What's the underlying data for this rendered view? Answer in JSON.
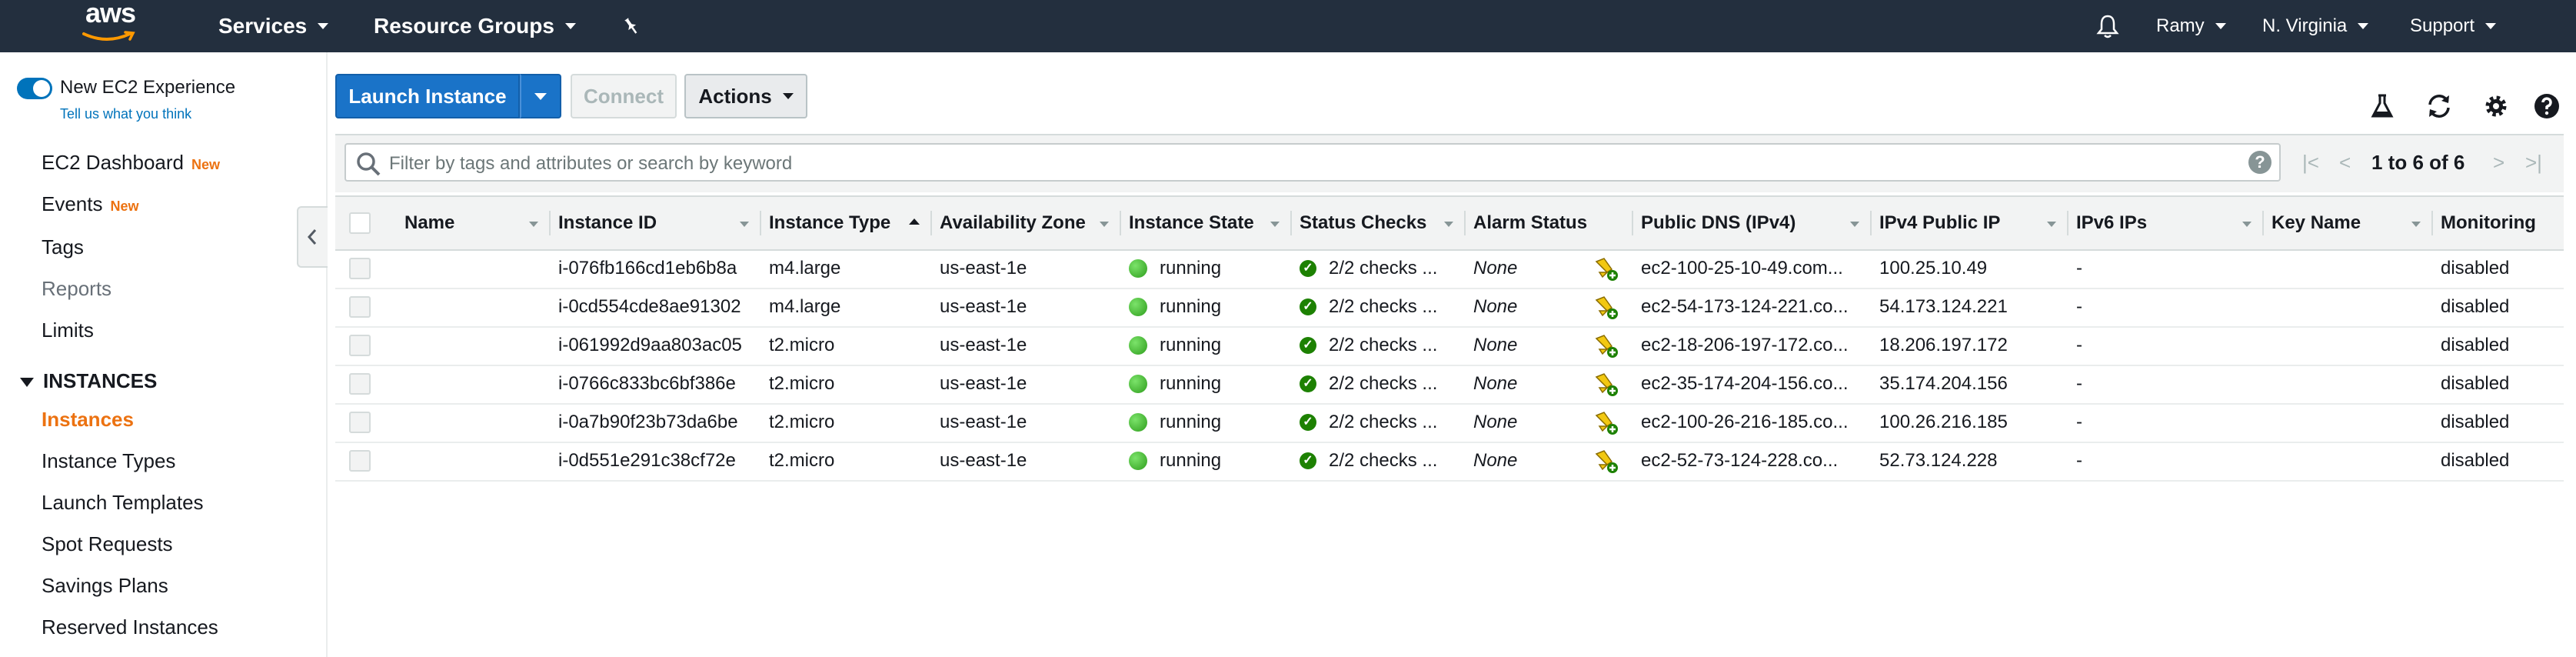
{
  "topnav": {
    "logo": "aws",
    "services": "Services",
    "resource_groups": "Resource Groups",
    "pin_icon": "pin-icon",
    "bell_icon": "bell-icon",
    "user": "Ramy",
    "region": "N. Virginia",
    "support": "Support"
  },
  "sidebar": {
    "toggle_label": "New EC2 Experience",
    "feedback_link": "Tell us what you think",
    "items": [
      {
        "label": "EC2 Dashboard",
        "badge": "New"
      },
      {
        "label": "Events",
        "badge": "New"
      },
      {
        "label": "Tags"
      },
      {
        "label": "Reports"
      },
      {
        "label": "Limits"
      }
    ],
    "section": "INSTANCES",
    "instances_items": [
      {
        "label": "Instances"
      },
      {
        "label": "Instance Types"
      },
      {
        "label": "Launch Templates"
      },
      {
        "label": "Spot Requests"
      },
      {
        "label": "Savings Plans"
      },
      {
        "label": "Reserved Instances"
      }
    ]
  },
  "toolbar": {
    "launch": "Launch Instance",
    "connect": "Connect",
    "actions": "Actions"
  },
  "filter": {
    "placeholder": "Filter by tags and attributes or search by keyword",
    "pager": "1 to 6 of 6"
  },
  "table": {
    "columns": [
      "Name",
      "Instance ID",
      "Instance Type",
      "Availability Zone",
      "Instance State",
      "Status Checks",
      "Alarm Status",
      "Public DNS (IPv4)",
      "IPv4 Public IP",
      "IPv6 IPs",
      "Key Name",
      "Monitoring"
    ],
    "rows": [
      {
        "name": "",
        "id": "i-076fb166cd1eb6b8a",
        "type": "m4.large",
        "az": "us-east-1e",
        "state": "running",
        "checks": "2/2 checks ...",
        "alarm": "None",
        "dns": "ec2-100-25-10-49.com...",
        "ip": "100.25.10.49",
        "ipv6": "-",
        "key": "",
        "monitoring": "disabled"
      },
      {
        "name": "",
        "id": "i-0cd554cde8ae91302",
        "type": "m4.large",
        "az": "us-east-1e",
        "state": "running",
        "checks": "2/2 checks ...",
        "alarm": "None",
        "dns": "ec2-54-173-124-221.co...",
        "ip": "54.173.124.221",
        "ipv6": "-",
        "key": "",
        "monitoring": "disabled"
      },
      {
        "name": "",
        "id": "i-061992d9aa803ac05",
        "type": "t2.micro",
        "az": "us-east-1e",
        "state": "running",
        "checks": "2/2 checks ...",
        "alarm": "None",
        "dns": "ec2-18-206-197-172.co...",
        "ip": "18.206.197.172",
        "ipv6": "-",
        "key": "",
        "monitoring": "disabled"
      },
      {
        "name": "",
        "id": "i-0766c833bc6bf386e",
        "type": "t2.micro",
        "az": "us-east-1e",
        "state": "running",
        "checks": "2/2 checks ...",
        "alarm": "None",
        "dns": "ec2-35-174-204-156.co...",
        "ip": "35.174.204.156",
        "ipv6": "-",
        "key": "",
        "monitoring": "disabled"
      },
      {
        "name": "",
        "id": "i-0a7b90f23b73da6be",
        "type": "t2.micro",
        "az": "us-east-1e",
        "state": "running",
        "checks": "2/2 checks ...",
        "alarm": "None",
        "dns": "ec2-100-26-216-185.co...",
        "ip": "100.26.216.185",
        "ipv6": "-",
        "key": "",
        "monitoring": "disabled"
      },
      {
        "name": "",
        "id": "i-0d551e291c38cf72e",
        "type": "t2.micro",
        "az": "us-east-1e",
        "state": "running",
        "checks": "2/2 checks ...",
        "alarm": "None",
        "dns": "ec2-52-73-124-228.co...",
        "ip": "52.73.124.228",
        "ipv6": "-",
        "key": "",
        "monitoring": "disabled"
      }
    ]
  },
  "colors": {
    "nav_bg": "#232f3e",
    "primary": "#1a73c8",
    "orange": "#ec7211",
    "running": "#2e9d1c"
  }
}
